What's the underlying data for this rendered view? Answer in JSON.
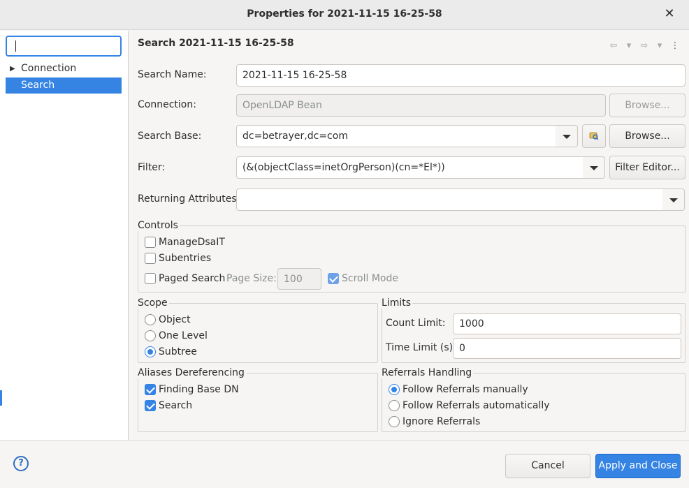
{
  "window": {
    "title": "Properties for 2021-11-15 16-25-58"
  },
  "sidebar": {
    "filter_value": "",
    "items": [
      {
        "label": "Connection",
        "expandable": true,
        "selected": false
      },
      {
        "label": "Search",
        "expandable": false,
        "selected": true
      }
    ]
  },
  "page": {
    "title": "Search 2021-11-15 16-25-58",
    "nav_icons": [
      "back-arrow-icon",
      "dropdown-icon",
      "forward-arrow-icon",
      "dropdown-icon",
      "more-icon"
    ]
  },
  "form": {
    "search_name": {
      "label": "Search Name:",
      "value": "2021-11-15 16-25-58"
    },
    "connection": {
      "label": "Connection:",
      "value": "OpenLDAP Bean",
      "browse": "Browse..."
    },
    "search_base": {
      "label": "Search Base:",
      "value": "dc=betrayer,dc=com",
      "browse": "Browse..."
    },
    "filter": {
      "label": "Filter:",
      "value": "(&(objectClass=inetOrgPerson)(cn=*El*))",
      "editor": "Filter Editor..."
    },
    "returning_attributes": {
      "label": "Returning Attributes:",
      "value": ""
    }
  },
  "controls": {
    "title": "Controls",
    "manage_dsait": {
      "label": "ManageDsaIT",
      "checked": false
    },
    "subentries": {
      "label": "Subentries",
      "checked": false
    },
    "paged_search": {
      "label": "Paged Search",
      "checked": false
    },
    "page_size": {
      "label": "Page Size:",
      "value": "100"
    },
    "scroll_mode": {
      "label": "Scroll Mode",
      "checked": true
    }
  },
  "scope": {
    "title": "Scope",
    "options": [
      {
        "label": "Object",
        "selected": false
      },
      {
        "label": "One Level",
        "selected": false
      },
      {
        "label": "Subtree",
        "selected": true
      }
    ]
  },
  "limits": {
    "title": "Limits",
    "count": {
      "label": "Count Limit:",
      "value": "1000"
    },
    "time": {
      "label": "Time Limit (s):",
      "value": "0"
    }
  },
  "aliases": {
    "title": "Aliases Dereferencing",
    "options": [
      {
        "label": "Finding Base DN",
        "checked": true
      },
      {
        "label": "Search",
        "checked": true
      }
    ]
  },
  "referrals": {
    "title": "Referrals Handling",
    "options": [
      {
        "label": "Follow Referrals manually",
        "selected": true
      },
      {
        "label": "Follow Referrals automatically",
        "selected": false
      },
      {
        "label": "Ignore Referrals",
        "selected": false
      }
    ]
  },
  "footer": {
    "help_symbol": "?",
    "cancel": "Cancel",
    "apply": "Apply and Close"
  },
  "colors": {
    "accent": "#3584e4",
    "background": "#f6f5f4"
  }
}
